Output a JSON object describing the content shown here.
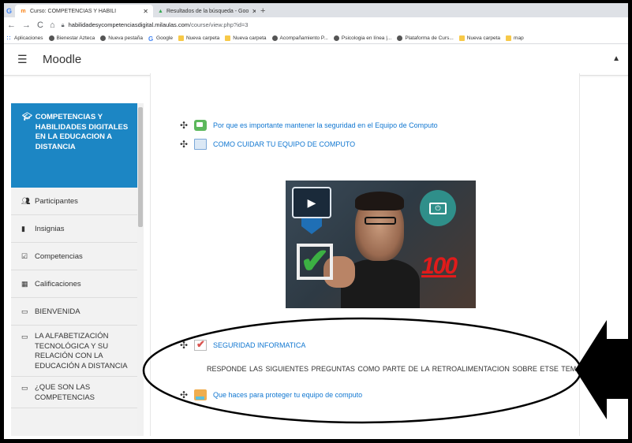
{
  "browser": {
    "tabs": [
      {
        "label": "Curso: COMPETENCIAS Y HABILI",
        "active": true
      },
      {
        "label": "Resultados de la búsqueda - Goo",
        "active": false
      }
    ],
    "google_tab_letter": "G",
    "new_tab_symbol": "+",
    "url_host": "habilidadesycompetenciasdigital.milaulas.com",
    "url_path": "/course/view.php?id=3",
    "bookmarks": [
      {
        "label": "Aplicaciones",
        "icon": "apps-icon"
      },
      {
        "label": "Bienestar Azteca",
        "icon": "globe-icon"
      },
      {
        "label": "Nueva pestaña",
        "icon": "globe-icon"
      },
      {
        "label": "Google",
        "icon": "google-icon"
      },
      {
        "label": "Nueva carpeta",
        "icon": "folder-icon"
      },
      {
        "label": "Nueva carpeta",
        "icon": "folder-icon"
      },
      {
        "label": "Acompañamiento P...",
        "icon": "globe-icon"
      },
      {
        "label": "Psicologia en línea |...",
        "icon": "globe-icon"
      },
      {
        "label": "Plataforma de Curs...",
        "icon": "globe-icon"
      },
      {
        "label": "Nueva carpeta",
        "icon": "folder-icon"
      },
      {
        "label": "map",
        "icon": "folder-icon"
      }
    ]
  },
  "header": {
    "brand": "Moodle"
  },
  "sidebar": {
    "course_title": "COMPETENCIAS Y HABILIDADES DIGITALES EN LA EDUCACION A DISTANCIA",
    "items": [
      {
        "label": "Participantes",
        "icon": "users-icon"
      },
      {
        "label": "Insignias",
        "icon": "badge-icon"
      },
      {
        "label": "Competencias",
        "icon": "checkbox-icon"
      },
      {
        "label": "Calificaciones",
        "icon": "table-icon"
      },
      {
        "label": "BIENVENIDA",
        "icon": "folder-icon"
      },
      {
        "label": "LA ALFABETIZACIÓN TECNOLÓGICA Y SU RELACIÓN CON LA EDUCACIÓN A DISTANCIA",
        "icon": "folder-icon"
      },
      {
        "label": "¿QUE SON LAS COMPETENCIAS",
        "icon": "folder-icon"
      }
    ]
  },
  "content": {
    "activities": [
      {
        "label": "Por que es importante mantener la seguridad en el Equipo de Computo",
        "icon": "forum-icon"
      },
      {
        "label": "COMO CUIDAR TU EQUIPO DE COMPUTO",
        "icon": "page-icon"
      },
      {
        "label": "SEGURIDAD INFORMATICA",
        "icon": "quiz-icon"
      },
      {
        "label": "Que haces para proteger tu equipo de computo",
        "icon": "assignment-icon"
      }
    ],
    "instruction": "RESPONDE LAS  SIGUIENTES  PREGUNTAS  COMO PARTE DE LA  RETROALIMENTACION SOBRE ETSE  TEMA",
    "video_badge": "100"
  },
  "colors": {
    "sidebar_active": "#1c86c4",
    "link": "#1177d1"
  }
}
